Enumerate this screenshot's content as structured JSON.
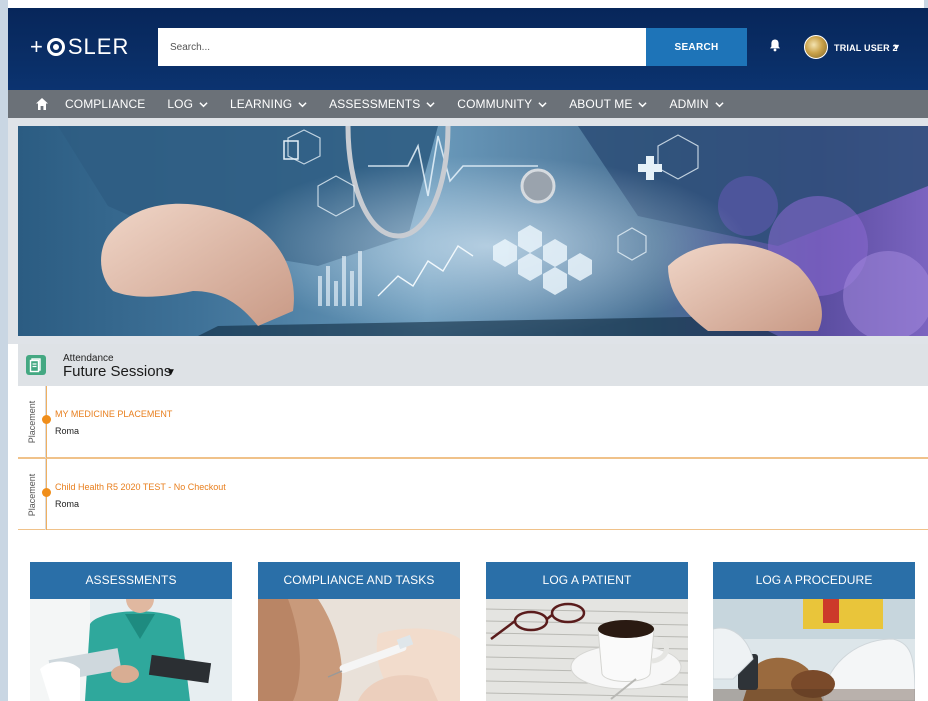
{
  "app": {
    "logo_text": "SLER",
    "logo_prefix": "+"
  },
  "header": {
    "search_placeholder": "Search...",
    "search_button": "SEARCH",
    "user_name": "TRIAL USER 2"
  },
  "nav": {
    "items": [
      {
        "label": "COMPLIANCE",
        "dropdown": false
      },
      {
        "label": "LOG",
        "dropdown": true
      },
      {
        "label": "LEARNING",
        "dropdown": true
      },
      {
        "label": "ASSESSMENTS",
        "dropdown": true
      },
      {
        "label": "COMMUNITY",
        "dropdown": true
      },
      {
        "label": "ABOUT ME",
        "dropdown": true
      },
      {
        "label": "ADMIN",
        "dropdown": true
      }
    ]
  },
  "attendance": {
    "subtitle": "Attendance",
    "title": "Future Sessions",
    "sessions": [
      {
        "type": "Placement",
        "name": "MY MEDICINE PLACEMENT",
        "location": "Roma"
      },
      {
        "type": "Placement",
        "name": "Child Health R5 2020 TEST - No Checkout",
        "location": "Roma"
      }
    ]
  },
  "tiles": [
    {
      "label": "ASSESSMENTS",
      "image": "clinicians-with-tablet"
    },
    {
      "label": "COMPLIANCE AND TASKS",
      "image": "vaccination-injection"
    },
    {
      "label": "LOG A PATIENT",
      "image": "coffee-and-glasses"
    },
    {
      "label": "LOG A PROCEDURE",
      "image": "gloved-hands-procedure"
    }
  ],
  "colors": {
    "header_bg": "#07265a",
    "nav_bg": "#6b7178",
    "accent_blue": "#1e74b8",
    "tile_blue": "#2a6fa8",
    "session_orange": "#e87f1e",
    "attendance_icon": "#44a882"
  }
}
